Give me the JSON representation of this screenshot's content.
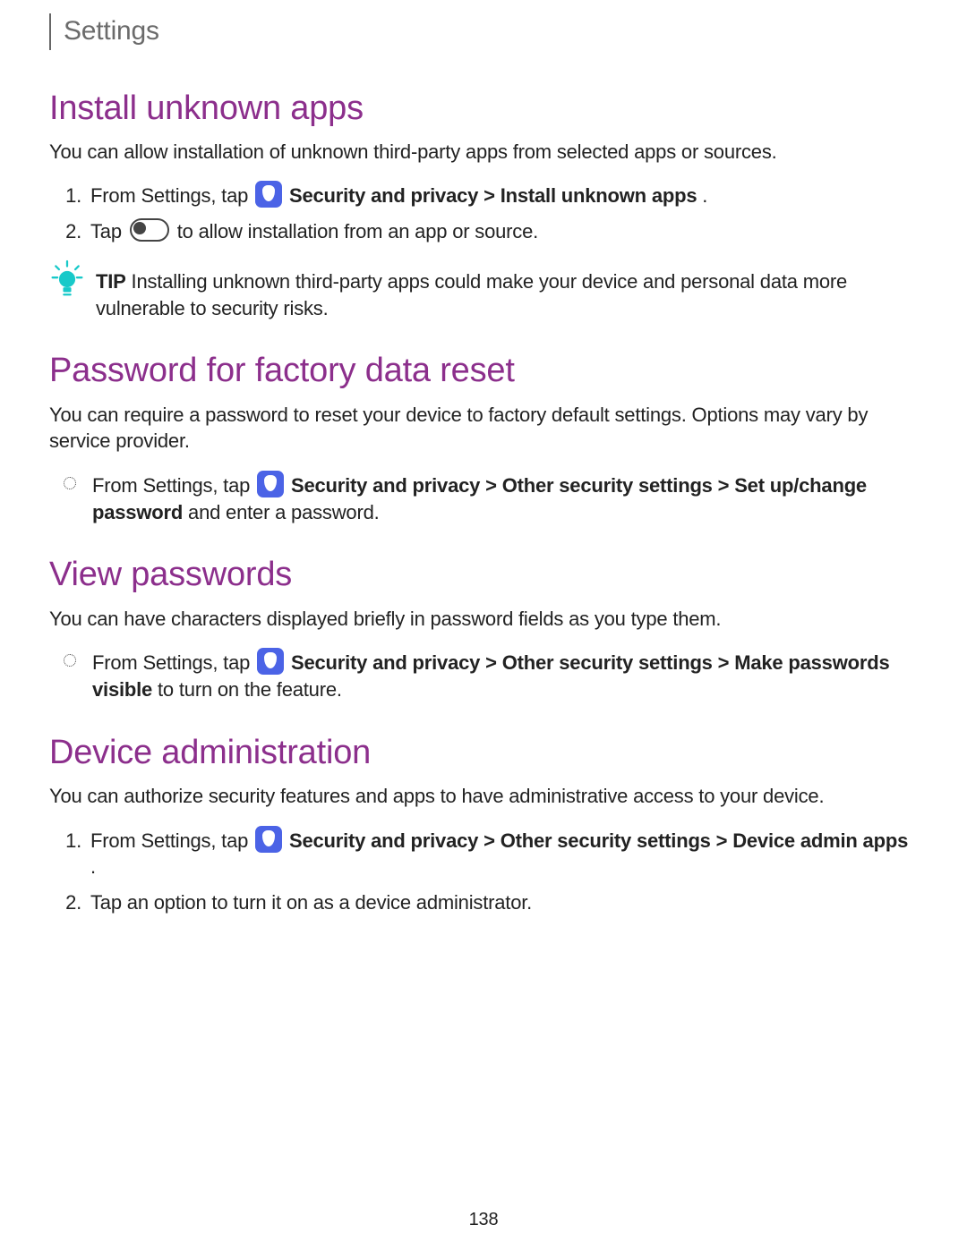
{
  "header": "Settings",
  "page_number": "138",
  "tip_label": "TIP",
  "bold": {
    "sec_priv": "Security and privacy",
    "install_unknown": "Install unknown apps",
    "other_sec": "Other security settings",
    "setup_change_pw": "Set up/change password",
    "make_pw_visible": "Make passwords visible",
    "device_admin_apps": "Device admin apps"
  },
  "sections": {
    "install_unknown": {
      "title": "Install unknown apps",
      "desc": "You can allow installation of unknown third-party apps from selected apps or sources.",
      "step1_pre": "From Settings, tap ",
      "step1_sep": " > ",
      "step1_end": ".",
      "step2_pre": "Tap ",
      "step2_post": " to allow installation from an app or source.",
      "tip": "Installing unknown third-party apps could make your device and personal data more vulnerable to security risks."
    },
    "factory_reset": {
      "title": "Password for factory data reset",
      "desc": "You can require a password to reset your device to factory default settings. Options may vary by service provider.",
      "bullet_pre": "From Settings, tap ",
      "bullet_sep": " > ",
      "bullet_post": " and enter a password."
    },
    "view_passwords": {
      "title": "View passwords",
      "desc": "You can have characters displayed briefly in password fields as you type them.",
      "bullet_pre": "From Settings, tap ",
      "bullet_sep": " > ",
      "bullet_post": " to turn on the feature."
    },
    "device_admin": {
      "title": "Device administration",
      "desc": "You can authorize security features and apps to have administrative access to your device.",
      "step1_pre": "From Settings, tap ",
      "step1_sep": " > ",
      "step1_end": ".",
      "step2": "Tap an option to turn it on as a device administrator."
    }
  }
}
